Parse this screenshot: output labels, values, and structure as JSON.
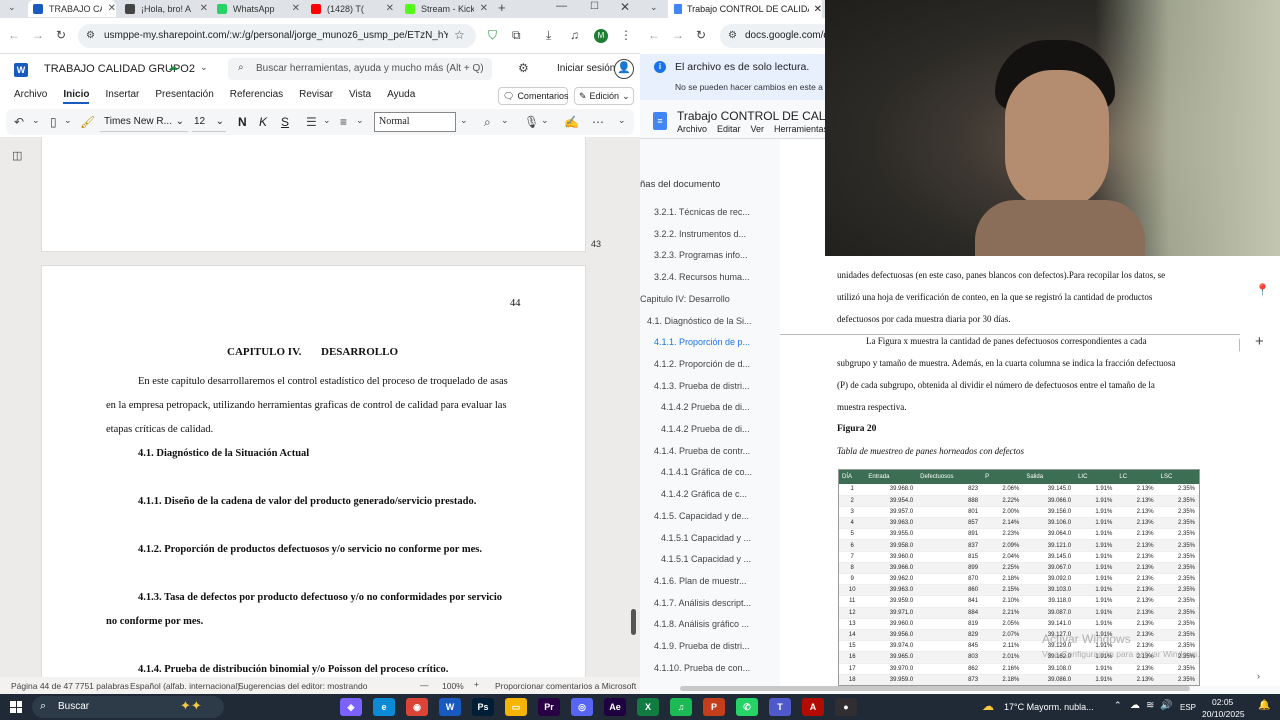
{
  "left_browser": {
    "tabs": [
      {
        "title": "TRABAJO CA",
        "color": "#185abd",
        "active": true
      },
      {
        "title": "¡Hola, bro! A",
        "color": "#444"
      },
      {
        "title": "WhatsApp",
        "color": "#25d366"
      },
      {
        "title": "(1428) T(",
        "color": "#ff0000"
      },
      {
        "title": "Stream - Kick",
        "color": "#53fc18"
      }
    ],
    "url": "usmppe-my.sharepoint.com/:w:/g/personal/jorge_munoz6_usmp_pe/ETzN_hYv_u...",
    "profile_initial": "M"
  },
  "word": {
    "doc_title": "TRABAJO CALIDAD GRUPO2",
    "search_placeholder": "Buscar herramientas, ayuda y mucho más (Alt + Q)",
    "signin": "Iniciar sesión",
    "menu": [
      "Archivo",
      "Inicio",
      "Insertar",
      "Presentación",
      "Referencias",
      "Revisar",
      "Vista",
      "Ayuda"
    ],
    "comments_btn": "Comentarios",
    "edit_btn": "Edición",
    "font_name": "Times New R...",
    "font_size": "12",
    "style": "Normal",
    "bold": "N",
    "italic": "K",
    "underline": "S",
    "page_num_prev": "43",
    "page_num": "44",
    "chapter": "CAPITULO IV.",
    "chapter_title": "DESARROLLO",
    "para1_line1": "En este capítulo desarrollaremos el control estadístico del proceso de troquelado de asas",
    "para1_line2": "en la empresa petropack, utilizando herramientas graficas de control de calidad para evaluar las",
    "para1_line3": "etapas críticas de calidad.",
    "h1": "4.1. Diagnóstico de la Situación Actual",
    "h2": "4.1.1. Diseño de la cadena de valor del producto generado/servicio prestado.",
    "h3": "4.1.2. Proporción de productos defectuosos y/o servicio no conforme por mes.",
    "h4a": "4.1.3. Tasa de defectos por producto defectuoso y/o no conformidades por servicio",
    "h4b": "no conforme por mes.",
    "h5": "4.1.4. Prueba de distribución binomial y/o Poisson del proceso crítico.",
    "status": {
      "page": "Página 44 de 47",
      "words": "7751 palabras",
      "lang": "Español (alfab. internacional)",
      "suggest": "Sugerencias del editor: mostrando",
      "zoom": "100%",
      "feedback": "Proporcionar comentarios a Microsoft"
    }
  },
  "right_browser": {
    "tab_title": "Trabajo CONTROL DE CALIDA",
    "url": "docs.google.com/d",
    "readonly_title": "El archivo es de solo lectura.",
    "readonly_sub": "No se pueden hacer cambios en este a",
    "doc_title": "Trabajo CONTROL DE CALIDAD",
    "menu": [
      "Archivo",
      "Editar",
      "Ver",
      "Herramientas"
    ],
    "outline_header": "ñas del documento",
    "outline": [
      {
        "t": "3.2.1. Técnicas de rec...",
        "i": 1
      },
      {
        "t": "3.2.2. Instrumentos d...",
        "i": 1
      },
      {
        "t": "3.2.3. Programas info...",
        "i": 1
      },
      {
        "t": "3.2.4. Recursos huma...",
        "i": 1
      },
      {
        "t": "Capitulo IV: Desarrollo",
        "i": 0
      },
      {
        "t": "4.1. Diagnóstico de la Si...",
        "i": 0.5
      },
      {
        "t": "4.1.1. Proporción de p...",
        "i": 1,
        "active": true
      },
      {
        "t": "4.1.2. Proporción de d...",
        "i": 1
      },
      {
        "t": "4.1.3. Prueba de distri...",
        "i": 1
      },
      {
        "t": "4.1.4.2 Prueba de di...",
        "i": 2
      },
      {
        "t": "4.1.4.2 Prueba de di...",
        "i": 2
      },
      {
        "t": "4.1.4. Prueba de contr...",
        "i": 1
      },
      {
        "t": "4.1.4.1 Gráfica de co...",
        "i": 2
      },
      {
        "t": "4.1.4.2 Gráfica de c...",
        "i": 2
      },
      {
        "t": "4.1.5. Capacidad y de...",
        "i": 1
      },
      {
        "t": "4.1.5.1 Capacidad y ...",
        "i": 2
      },
      {
        "t": "4.1.5.1 Capacidad y ...",
        "i": 2
      },
      {
        "t": "4.1.6. Plan de muestr...",
        "i": 1
      },
      {
        "t": "4.1.7. Análisis descript...",
        "i": 1
      },
      {
        "t": "4.1.8. Análisis gráfico ...",
        "i": 1
      },
      {
        "t": "4.1.9. Prueba de distri...",
        "i": 1
      },
      {
        "t": "4.1.10. Prueba de con...",
        "i": 1
      }
    ],
    "p1": "unidades defectuosas (en este caso, panes blancos con defectos).Para recopilar los datos, se",
    "p2": "utilizó una hoja de verificación de conteo, en la que se registró la cantidad de productos",
    "p3": "defectuosos por cada muestra diaria por 30 días.",
    "p4": "La Figura x  muestra la cantidad de panes defectuosos correspondientes a cada",
    "p5": "subgrupo y tamaño de muestra. Además, en la cuarta columna se indica la fracción defectuosa",
    "p6": "(P) de cada subgrupo, obtenida al dividir el número de defectuosos entre el tamaño de la",
    "p7": "muestra respectiva.",
    "fig_label": "Figura 20",
    "fig_caption": "Tabla de muestreo de panes horneados con defectos",
    "table_headers": [
      "DÍA",
      "Entrada",
      "Defectuosos",
      "P",
      "Salida",
      "LIC",
      "LC",
      "LSC"
    ],
    "table_rows": [
      [
        "1",
        "39.968.0",
        "823",
        "2.06%",
        "39.145.0",
        "1.91%",
        "2.13%",
        "2.35%"
      ],
      [
        "2",
        "39.954.0",
        "888",
        "2.22%",
        "39.066.0",
        "1.91%",
        "2.13%",
        "2.35%"
      ],
      [
        "3",
        "39.957.0",
        "801",
        "2.00%",
        "39.156.0",
        "1.91%",
        "2.13%",
        "2.35%"
      ],
      [
        "4",
        "39.963.0",
        "857",
        "2.14%",
        "39.106.0",
        "1.91%",
        "2.13%",
        "2.35%"
      ],
      [
        "5",
        "39.955.0",
        "891",
        "2.23%",
        "39.064.0",
        "1.91%",
        "2.13%",
        "2.35%"
      ],
      [
        "6",
        "39.958.0",
        "837",
        "2.09%",
        "39.121.0",
        "1.91%",
        "2.13%",
        "2.35%"
      ],
      [
        "7",
        "39.960.0",
        "815",
        "2.04%",
        "39.145.0",
        "1.91%",
        "2.13%",
        "2.35%"
      ],
      [
        "8",
        "39.966.0",
        "899",
        "2.25%",
        "39.067.0",
        "1.91%",
        "2.13%",
        "2.35%"
      ],
      [
        "9",
        "39.962.0",
        "870",
        "2.18%",
        "39.092.0",
        "1.91%",
        "2.13%",
        "2.35%"
      ],
      [
        "10",
        "39.963.0",
        "860",
        "2.15%",
        "39.103.0",
        "1.91%",
        "2.13%",
        "2.35%"
      ],
      [
        "11",
        "39.959.0",
        "841",
        "2.10%",
        "39.118.0",
        "1.91%",
        "2.13%",
        "2.35%"
      ],
      [
        "12",
        "39.971.0",
        "884",
        "2.21%",
        "39.087.0",
        "1.91%",
        "2.13%",
        "2.35%"
      ],
      [
        "13",
        "39.960.0",
        "819",
        "2.05%",
        "39.141.0",
        "1.91%",
        "2.13%",
        "2.35%"
      ],
      [
        "14",
        "39.956.0",
        "829",
        "2.07%",
        "39.127.0",
        "1.91%",
        "2.13%",
        "2.35%"
      ],
      [
        "15",
        "39.974.0",
        "845",
        "2.11%",
        "39.129.0",
        "1.91%",
        "2.13%",
        "2.35%"
      ],
      [
        "16",
        "39.965.0",
        "803",
        "2.01%",
        "39.162.0",
        "1.91%",
        "2.13%",
        "2.35%"
      ],
      [
        "17",
        "39.970.0",
        "862",
        "2.16%",
        "39.108.0",
        "1.91%",
        "2.13%",
        "2.35%"
      ],
      [
        "18",
        "39.959.0",
        "873",
        "2.18%",
        "39.086.0",
        "1.91%",
        "2.13%",
        "2.35%"
      ]
    ],
    "watermark1": "Activar Windows",
    "watermark2": "Ve a Configuración para activar Windows."
  },
  "taskbar": {
    "search": "Buscar",
    "weather": "17°C  Mayorm. nubla...",
    "lang": "ESP",
    "time": "02:05",
    "date": "20/10/2025"
  },
  "colors": {
    "word_blue": "#185abd",
    "accent_green": "#3c6e53"
  }
}
